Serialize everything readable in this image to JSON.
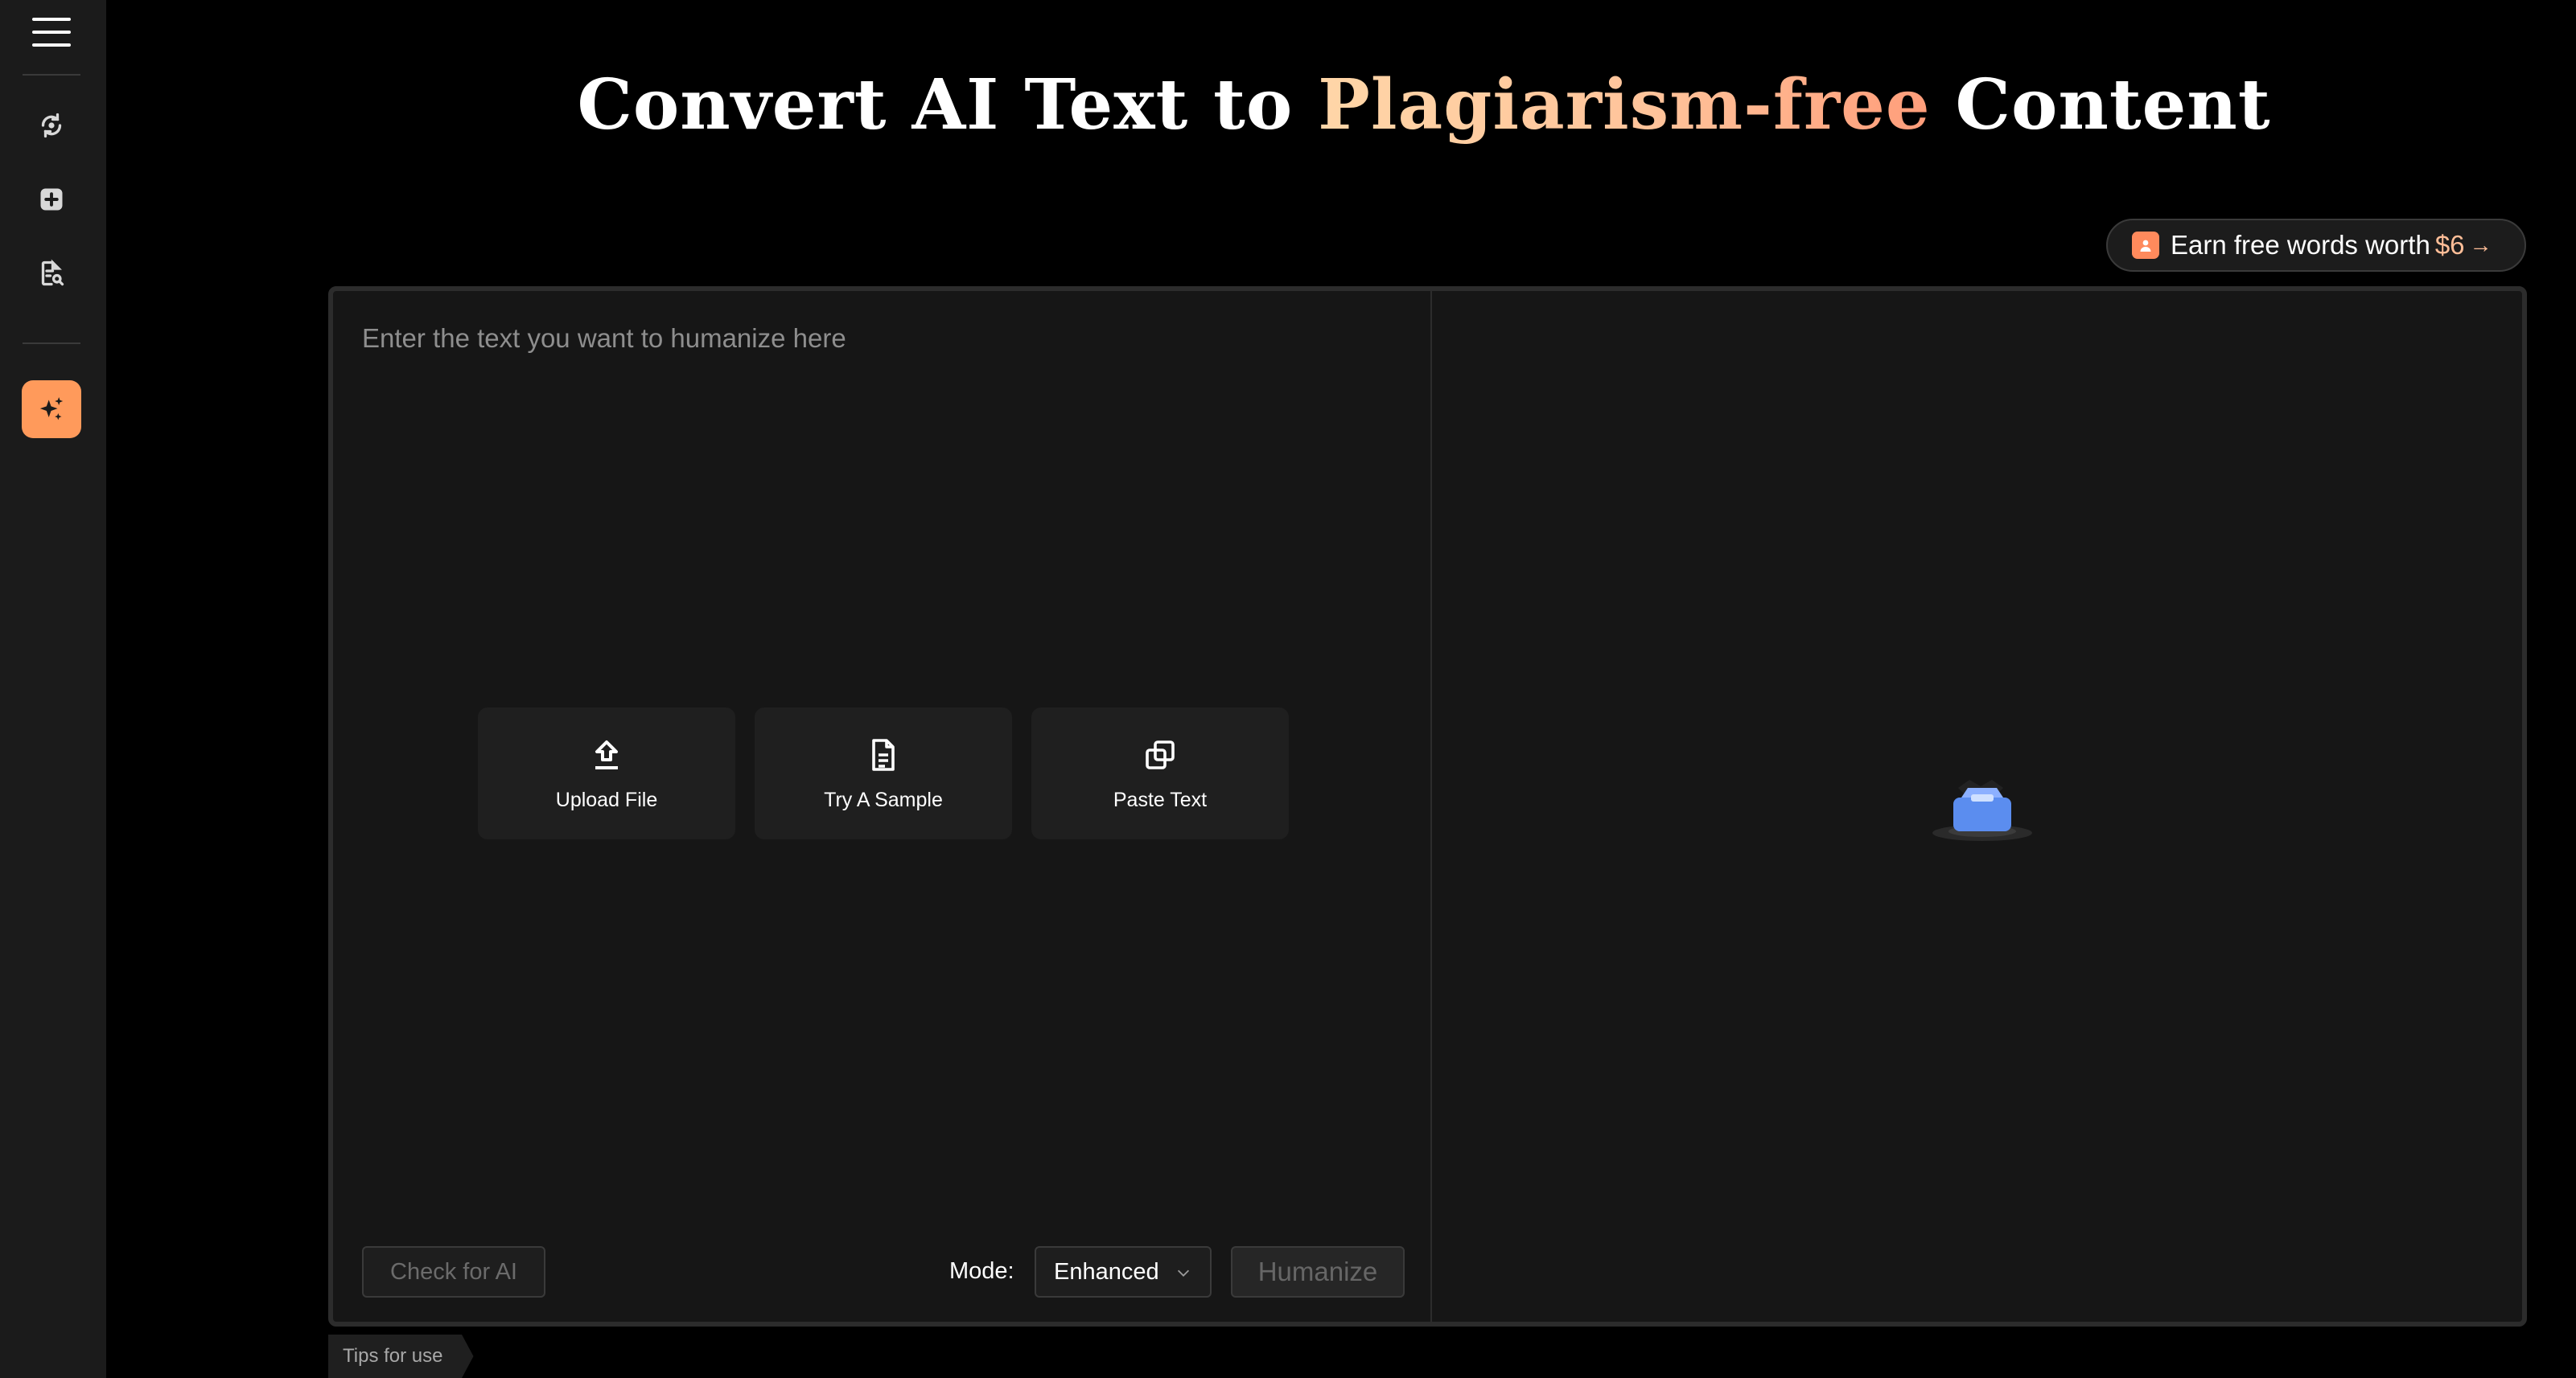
{
  "sidebar": {
    "menu_icon": "hamburger-icon",
    "items": [
      {
        "icon": "refresh-detect-icon"
      },
      {
        "icon": "plus-square-icon"
      },
      {
        "icon": "document-search-icon"
      }
    ],
    "active_item": {
      "icon": "sparkles-icon"
    },
    "active_color": "#ff9a5b"
  },
  "header": {
    "title_prefix": "Convert AI Text to ",
    "title_highlight": "Plagiarism-free",
    "title_suffix": " Content"
  },
  "earn": {
    "label": "Earn free words worth",
    "price": "$6",
    "arrow": "→"
  },
  "editor": {
    "placeholder": "Enter the text you want to humanize here",
    "actions": [
      {
        "label": "Upload File",
        "icon": "upload-icon"
      },
      {
        "label": "Try A Sample",
        "icon": "document-icon"
      },
      {
        "label": "Paste Text",
        "icon": "copy-icon"
      }
    ],
    "check_label": "Check for AI",
    "mode_label": "Mode:",
    "mode_value": "Enhanced",
    "humanize_label": "Humanize"
  },
  "output": {
    "empty_icon": "empty-box-icon"
  },
  "tips": {
    "label": "Tips for use"
  },
  "colors": {
    "accent": "#ff9a5b",
    "highlight_start": "#ffd6a8",
    "highlight_end": "#ff9d7a",
    "background": "#000000",
    "panel": "#161616"
  }
}
